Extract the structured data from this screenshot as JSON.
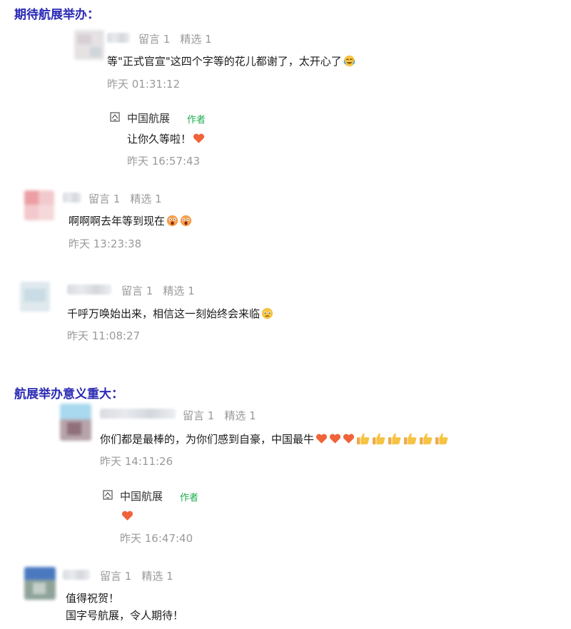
{
  "sections": [
    {
      "title": "期待航展举办："
    },
    {
      "title": "航展举办意义重大："
    }
  ],
  "labels": {
    "reply_count": "留言 1",
    "featured_count": "精选 1",
    "author_name": "中国航展",
    "author_badge": "作者"
  },
  "comments": [
    {
      "text": "等\"正式官宣\"这四个字等的花儿都谢了，太开心了",
      "time": "昨天 01:31:12",
      "reply": {
        "text": "让你久等啦！",
        "time": "昨天 16:57:43"
      }
    },
    {
      "text": "啊啊啊去年等到现在",
      "time": "昨天 13:23:38"
    },
    {
      "text": "千呼万唤始出来，相信这一刻始终会来临",
      "time": "昨天 11:08:27"
    },
    {
      "text": "你们都是最棒的，为你们感到自豪，中国最牛",
      "time": "昨天 14:11:26",
      "reply": {
        "text": "",
        "time": "昨天 16:47:40"
      }
    },
    {
      "text_line1": "值得祝贺！",
      "text_line2": "国字号航展，令人期待！"
    }
  ],
  "colors": {
    "section_title": "#2a2ab5",
    "meta_gray": "#9a9a9a",
    "author_badge": "#1aad4f",
    "heart": "#f0633a"
  },
  "icons": [
    "crying-laugh-emoji",
    "shocked-emoji",
    "teary-emoji",
    "heart-icon",
    "thumbs-up-icon",
    "author-logo-icon"
  ]
}
